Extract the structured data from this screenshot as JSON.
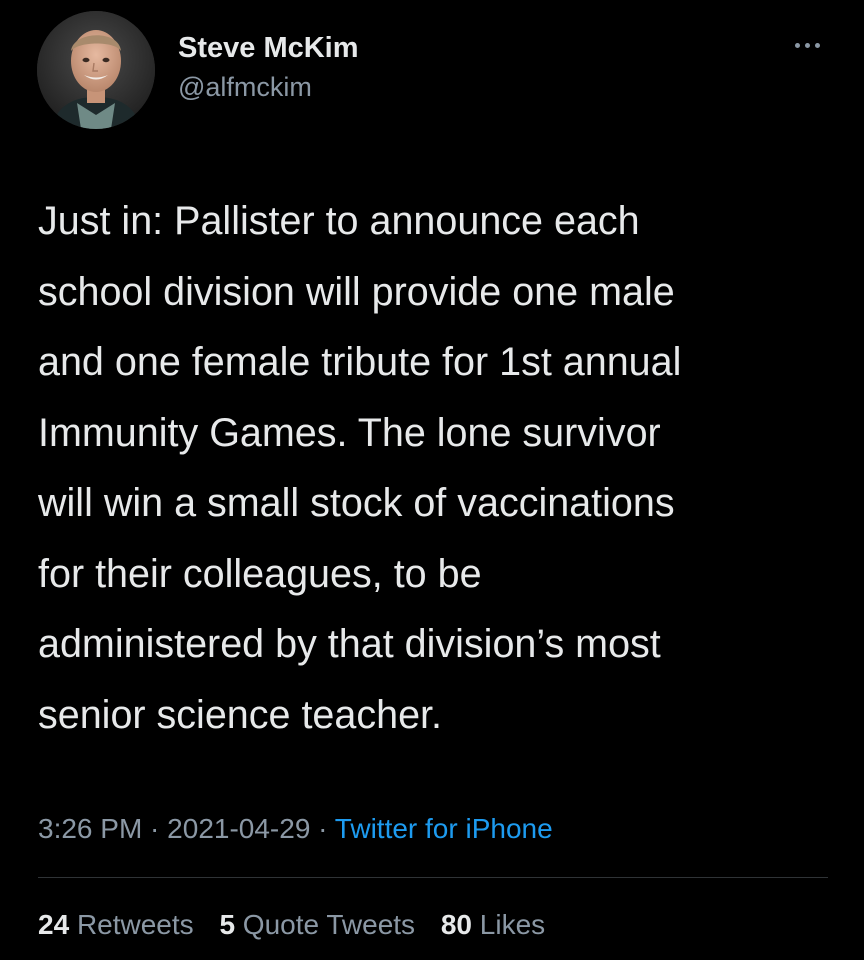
{
  "author": {
    "display_name": "Steve McKim",
    "handle": "@alfmckim"
  },
  "tweet": {
    "lines": [
      "Just in: Pallister to announce each",
      "school division will provide one male",
      "and one female tribute for 1st annual",
      "Immunity Games. The lone survivor",
      "will win a small stock of vaccinations",
      "for their colleagues, to be",
      "administered by that division’s most",
      "senior science teacher."
    ]
  },
  "meta": {
    "time": "3:26 PM",
    "separator": " · ",
    "date": "2021-04-29",
    "source": "Twitter for iPhone"
  },
  "stats": {
    "retweets_count": "24",
    "retweets_label": "Retweets",
    "quotes_count": "5",
    "quotes_label": "Quote Tweets",
    "likes_count": "80",
    "likes_label": "Likes"
  },
  "icons": {
    "more": "more-horizontal-icon"
  },
  "colors": {
    "background": "#000000",
    "text": "#e7e9ea",
    "secondary": "#8b98a5",
    "link": "#1d9bf0"
  }
}
